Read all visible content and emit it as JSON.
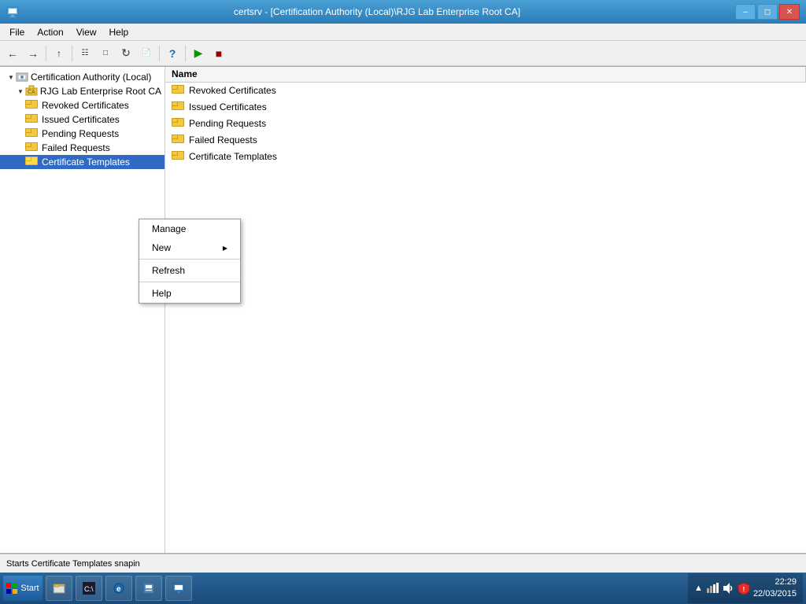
{
  "titleBar": {
    "title": "certsrv - [Certification Authority (Local)\\RJG Lab Enterprise Root CA]",
    "icon": "cert-icon"
  },
  "menuBar": {
    "items": [
      "File",
      "Action",
      "View",
      "Help"
    ]
  },
  "toolbar": {
    "buttons": [
      "back",
      "forward",
      "up",
      "show-hide-console-tree",
      "new-window",
      "refresh",
      "export-list",
      "help",
      "play",
      "stop"
    ]
  },
  "leftPanel": {
    "tree": {
      "root": {
        "label": "Certification Authority (Local)",
        "children": [
          {
            "label": "RJG Lab Enterprise Root CA",
            "expanded": true,
            "selected": false,
            "children": [
              {
                "label": "Revoked Certificates"
              },
              {
                "label": "Issued Certificates"
              },
              {
                "label": "Pending Requests"
              },
              {
                "label": "Failed Requests"
              },
              {
                "label": "Certificate Templates",
                "selected": true
              }
            ]
          }
        ]
      }
    }
  },
  "rightPanel": {
    "columnHeader": "Name",
    "items": [
      {
        "label": "Revoked Certificates"
      },
      {
        "label": "Issued Certificates"
      },
      {
        "label": "Pending Requests"
      },
      {
        "label": "Failed Requests"
      },
      {
        "label": "Certificate Templates"
      }
    ]
  },
  "contextMenu": {
    "items": [
      {
        "label": "Manage",
        "hasSubmenu": false
      },
      {
        "label": "New",
        "hasSubmenu": true
      },
      {
        "label": "Refresh",
        "hasSubmenu": false
      },
      {
        "label": "Help",
        "hasSubmenu": false
      }
    ]
  },
  "statusBar": {
    "left": "Starts Certificate Templates snapin",
    "right": ""
  },
  "taskbar": {
    "startLabel": "Start",
    "buttons": [
      {
        "icon": "file-explorer-icon",
        "label": ""
      },
      {
        "icon": "cmd-icon",
        "label": ""
      },
      {
        "icon": "ie-icon",
        "label": ""
      },
      {
        "icon": "server-manager-icon",
        "label": ""
      },
      {
        "icon": "rdp-icon",
        "label": ""
      }
    ],
    "tray": {
      "icons": [
        "network-icon",
        "audio-icon",
        "security-icon"
      ],
      "time": "22:29",
      "date": "22/03/2015"
    }
  }
}
